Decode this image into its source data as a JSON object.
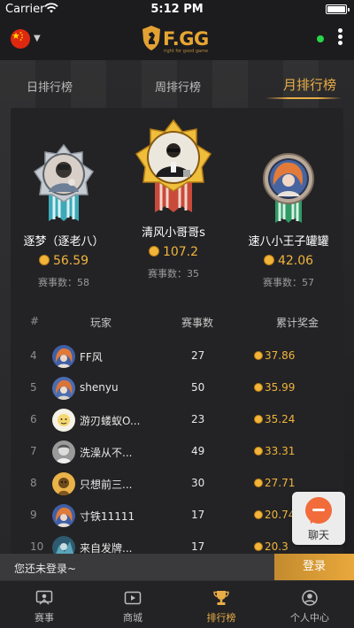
{
  "status_bar": {
    "carrier": "Carrier",
    "time": "5:12 PM"
  },
  "header": {
    "logo_text": "F.GG",
    "logo_tagline": "right for good game",
    "online_indicator_color": "#28d64a"
  },
  "tabs": [
    {
      "label": "日排行榜",
      "active": false
    },
    {
      "label": "周排行榜",
      "active": false
    },
    {
      "label": "月排行榜",
      "active": true
    }
  ],
  "podium": [
    {
      "place": 2,
      "name": "逐梦（逐老八）",
      "prize": "56.59",
      "matches_label": "赛事数：",
      "matches": "58"
    },
    {
      "place": 1,
      "name": "清风小哥哥s",
      "prize": "107.2",
      "matches_label": "赛事数：",
      "matches": "35"
    },
    {
      "place": 3,
      "name": "速八小王子罐罐",
      "prize": "42.06",
      "matches_label": "赛事数：",
      "matches": "57"
    }
  ],
  "table": {
    "headers": {
      "rank": "#",
      "player": "玩家",
      "matches": "赛事数",
      "prize": "累计奖金"
    },
    "rows": [
      {
        "rank": "4",
        "name": "FF风",
        "matches": "27",
        "prize": "37.86"
      },
      {
        "rank": "5",
        "name": "shenyu",
        "matches": "50",
        "prize": "35.99"
      },
      {
        "rank": "6",
        "name": "游刃蝼蚁O...",
        "matches": "23",
        "prize": "35.24"
      },
      {
        "rank": "7",
        "name": "洗澡从不...",
        "matches": "49",
        "prize": "33.31"
      },
      {
        "rank": "8",
        "name": "只想前三...",
        "matches": "30",
        "prize": "27.71"
      },
      {
        "rank": "9",
        "name": "寸铁11111",
        "matches": "17",
        "prize": "20.74"
      },
      {
        "rank": "10",
        "name": "来自发牌...",
        "matches": "17",
        "prize": "20.3"
      }
    ]
  },
  "chat": {
    "label": "聊天"
  },
  "login_bar": {
    "message": "您还未登录~",
    "button": "登录"
  },
  "tabbar": [
    {
      "label": "赛事",
      "icon": "tournament-icon",
      "active": false
    },
    {
      "label": "商城",
      "icon": "video-icon",
      "active": false
    },
    {
      "label": "排行榜",
      "icon": "trophy-icon",
      "active": true
    },
    {
      "label": "个人中心",
      "icon": "profile-icon",
      "active": false
    }
  ],
  "colors": {
    "accent": "#e9ad46",
    "chat": "#f26b3a",
    "background": "#1b1b1d"
  }
}
